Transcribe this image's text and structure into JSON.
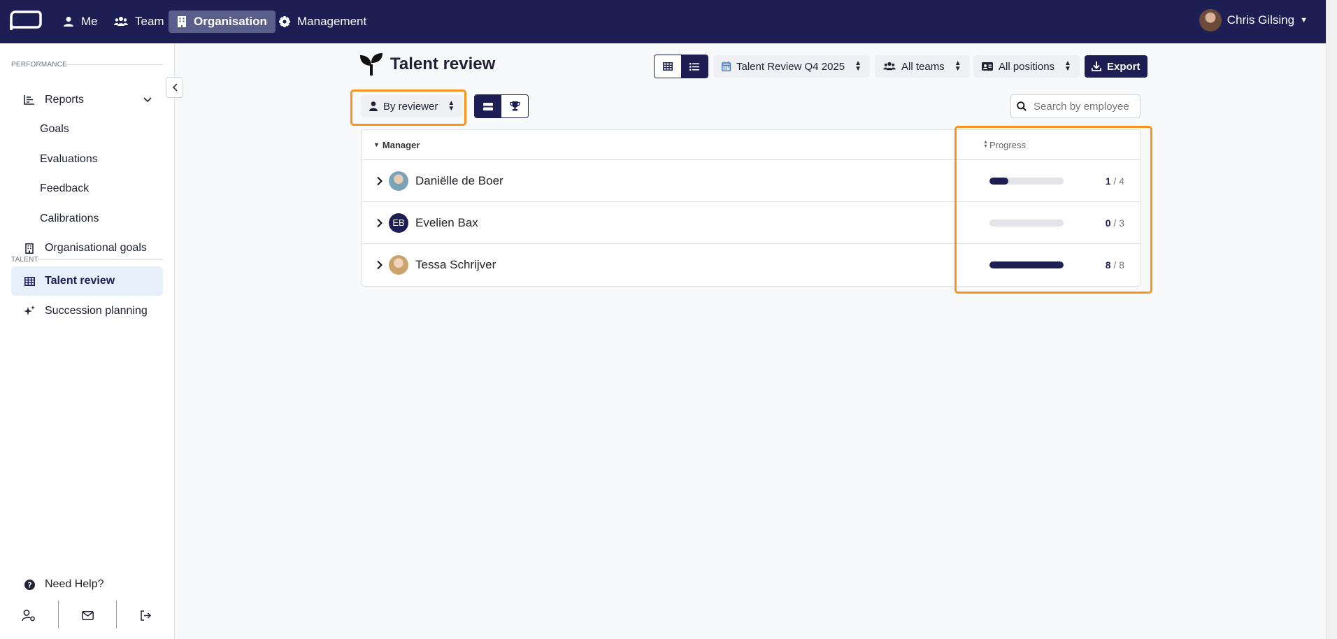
{
  "topnav": {
    "items": [
      {
        "label": "Me"
      },
      {
        "label": "Team"
      },
      {
        "label": "Organisation"
      },
      {
        "label": "Management"
      }
    ],
    "user": "Chris Gilsing"
  },
  "sidebar": {
    "performance_label": "PERFORMANCE",
    "talent_label": "TALENT",
    "items": [
      {
        "label": "Reports"
      },
      {
        "label": "Goals"
      },
      {
        "label": "Evaluations"
      },
      {
        "label": "Feedback"
      },
      {
        "label": "Calibrations"
      },
      {
        "label": "Organisational goals"
      },
      {
        "label": "Talent review"
      },
      {
        "label": "Succession planning"
      }
    ],
    "help": "Need Help?"
  },
  "main": {
    "title": "Talent review",
    "cycle": "Talent Review Q4 2025",
    "teams": "All teams",
    "positions": "All positions",
    "export": "Export",
    "group_by": "By reviewer",
    "search_placeholder": "Search by employee"
  },
  "table": {
    "col_manager": "Manager",
    "col_progress": "Progress",
    "rows": [
      {
        "name": "Daniëlle de Boer",
        "done": "1",
        "total": "/ 4",
        "progress": 0.25
      },
      {
        "name": "Evelien Bax",
        "initials": "EB",
        "done": "0",
        "total": "/ 3",
        "progress": 0
      },
      {
        "name": "Tessa Schrijver",
        "done": "8",
        "total": "/ 8",
        "progress": 1
      }
    ]
  }
}
